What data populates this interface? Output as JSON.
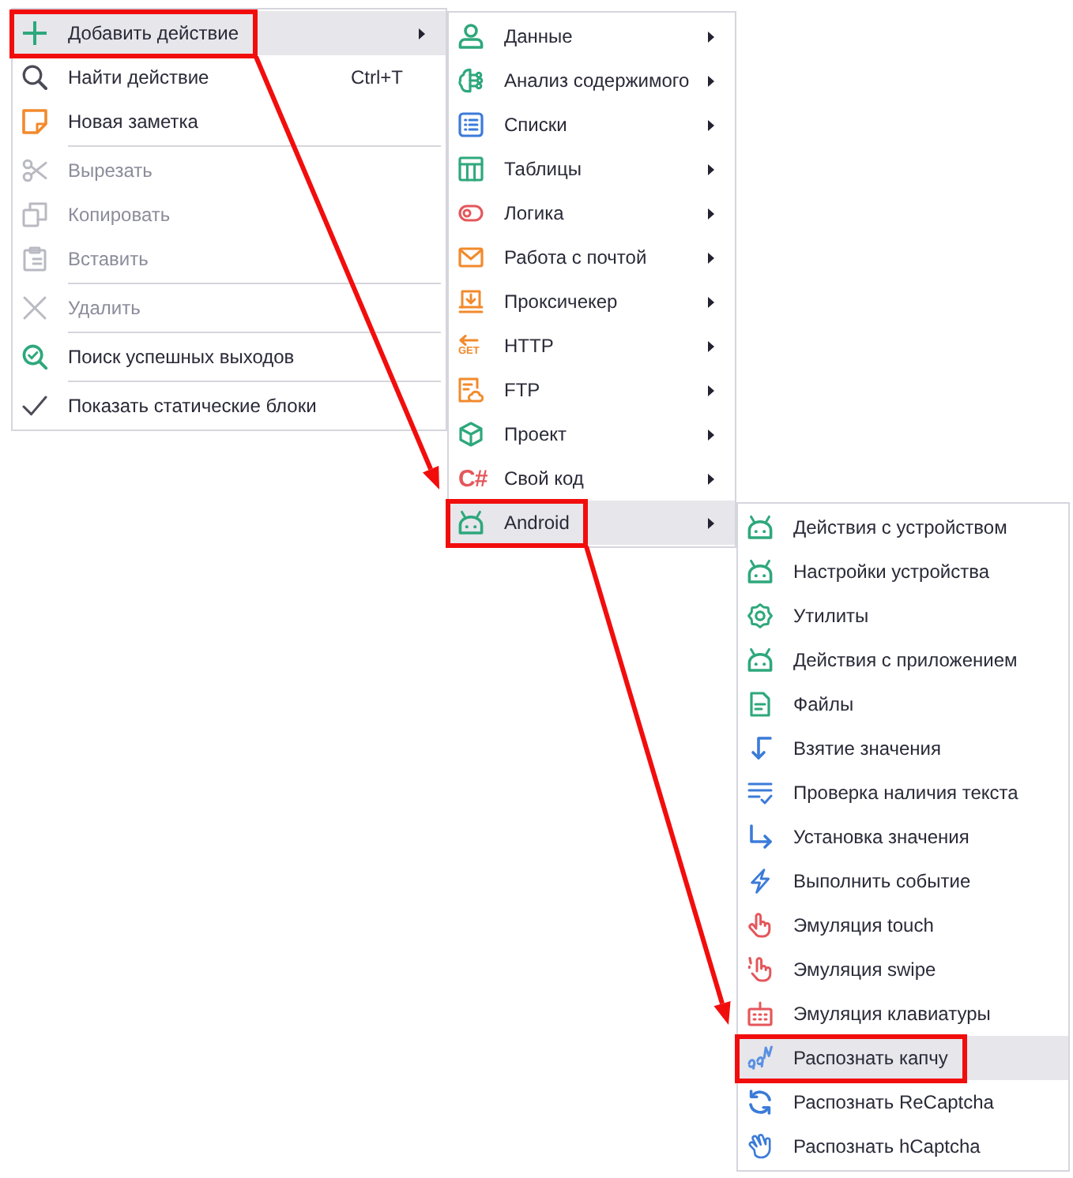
{
  "menus": [
    {
      "items": [
        {
          "kind": "item",
          "label": "Добавить действие",
          "selected": true,
          "disabled": false,
          "submenu": true,
          "framed": true
        },
        {
          "kind": "item",
          "label": "Найти действие",
          "shortcut": "Ctrl+T",
          "selected": false,
          "disabled": false,
          "submenu": false,
          "framed": false
        },
        {
          "kind": "item",
          "label": "Новая заметка",
          "selected": false,
          "disabled": false,
          "submenu": false,
          "framed": false
        },
        {
          "kind": "separator"
        },
        {
          "kind": "item",
          "label": "Вырезать",
          "selected": false,
          "disabled": true,
          "submenu": false,
          "framed": false
        },
        {
          "kind": "item",
          "label": "Копировать",
          "selected": false,
          "disabled": true,
          "submenu": false,
          "framed": false
        },
        {
          "kind": "item",
          "label": "Вставить",
          "selected": false,
          "disabled": true,
          "submenu": false,
          "framed": false
        },
        {
          "kind": "separator"
        },
        {
          "kind": "item",
          "label": "Удалить",
          "selected": false,
          "disabled": true,
          "submenu": false,
          "framed": false
        },
        {
          "kind": "separator"
        },
        {
          "kind": "item",
          "label": "Поиск успешных выходов",
          "selected": false,
          "disabled": false,
          "submenu": false,
          "framed": false
        },
        {
          "kind": "separator"
        },
        {
          "kind": "check",
          "label": "Показать статические блоки",
          "checked": true,
          "selected": false,
          "disabled": false,
          "submenu": false,
          "framed": false
        }
      ]
    },
    {
      "items": [
        {
          "kind": "item",
          "label": "Данные",
          "selected": false,
          "submenu": true,
          "framed": false
        },
        {
          "kind": "item",
          "label": "Анализ содержимого",
          "selected": false,
          "submenu": true,
          "framed": false
        },
        {
          "kind": "item",
          "label": "Списки",
          "selected": false,
          "submenu": true,
          "framed": false
        },
        {
          "kind": "item",
          "label": "Таблицы",
          "selected": false,
          "submenu": true,
          "framed": false
        },
        {
          "kind": "item",
          "label": "Логика",
          "selected": false,
          "submenu": true,
          "framed": false
        },
        {
          "kind": "item",
          "label": "Работа с почтой",
          "selected": false,
          "submenu": true,
          "framed": false
        },
        {
          "kind": "item",
          "label": "Проксичекер",
          "selected": false,
          "submenu": true,
          "framed": false
        },
        {
          "kind": "item",
          "label": "HTTP",
          "icon_text": "GET",
          "selected": false,
          "submenu": true,
          "framed": false
        },
        {
          "kind": "item",
          "label": "FTP",
          "selected": false,
          "submenu": true,
          "framed": false
        },
        {
          "kind": "item",
          "label": "Проект",
          "selected": false,
          "submenu": true,
          "framed": false
        },
        {
          "kind": "item",
          "label": "Свой код",
          "icon_text": "C#",
          "selected": false,
          "submenu": true,
          "framed": false
        },
        {
          "kind": "item",
          "label": "Android",
          "selected": true,
          "submenu": true,
          "framed": true
        }
      ]
    },
    {
      "items": [
        {
          "kind": "item",
          "label": "Действия с устройством",
          "selected": false,
          "framed": false
        },
        {
          "kind": "item",
          "label": "Настройки устройства",
          "selected": false,
          "framed": false
        },
        {
          "kind": "item",
          "label": "Утилиты",
          "selected": false,
          "framed": false
        },
        {
          "kind": "item",
          "label": "Действия с приложением",
          "selected": false,
          "framed": false
        },
        {
          "kind": "item",
          "label": "Файлы",
          "selected": false,
          "framed": false
        },
        {
          "kind": "item",
          "label": "Взятие значения",
          "selected": false,
          "framed": false
        },
        {
          "kind": "item",
          "label": "Проверка наличия текста",
          "selected": false,
          "framed": false
        },
        {
          "kind": "item",
          "label": "Установка значения",
          "selected": false,
          "framed": false
        },
        {
          "kind": "item",
          "label": "Выполнить событие",
          "selected": false,
          "framed": false
        },
        {
          "kind": "item",
          "label": "Эмуляция touch",
          "selected": false,
          "framed": false
        },
        {
          "kind": "item",
          "label": "Эмуляция swipe",
          "selected": false,
          "framed": false
        },
        {
          "kind": "item",
          "label": "Эмуляция клавиатуры",
          "selected": false,
          "framed": false
        },
        {
          "kind": "item",
          "label": "Распознать капчу",
          "selected": true,
          "framed": true
        },
        {
          "kind": "item",
          "label": "Распознать ReCaptcha",
          "selected": false,
          "framed": false
        },
        {
          "kind": "item",
          "label": "Распознать hCaptcha",
          "selected": false,
          "framed": false
        }
      ]
    }
  ]
}
